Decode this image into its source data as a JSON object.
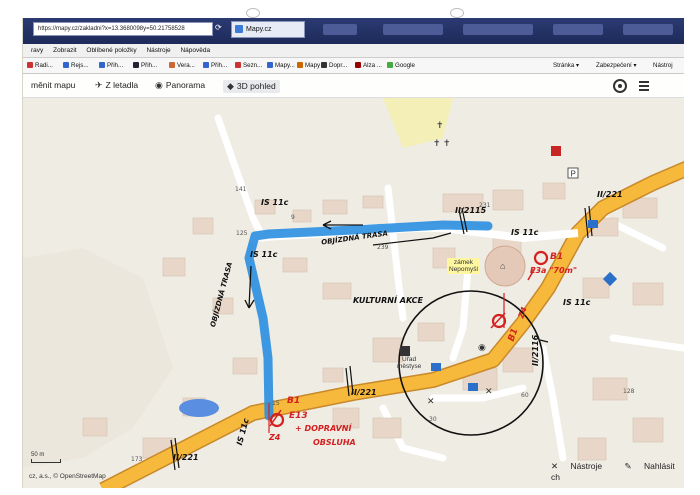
{
  "browser": {
    "address": "https://mapy.cz/zakladni?x=13.3680098y=50.21758528",
    "tab_label": "Mapy.cz",
    "menu": [
      "ravy",
      "Zobrazit",
      "Oblíbené položky",
      "Nástroje",
      "Nápověda"
    ],
    "favorites": [
      "Radi...",
      "Rejs...",
      "Přih...",
      "Přih...",
      "Vera...",
      "Přih...",
      "Sezn...",
      "Mapy...",
      "Mapy",
      "Dopr...",
      "Alza ...",
      "Google"
    ],
    "commands": [
      "Stránka ▾",
      "Zabezpečení ▾",
      "Nástroj"
    ]
  },
  "map_toolbar": {
    "change_map": "měnit mapu",
    "aerial": "Z letadla",
    "panorama": "Panorama",
    "view_3d": "3D pohled"
  },
  "map_labels": {
    "zamek": "zámek",
    "nepomysl": "Nepomyšl",
    "urad": "Úřad",
    "mestyse": "městyse",
    "numbers": [
      "141",
      "125",
      "9",
      "239",
      "231",
      "15",
      "60",
      "30",
      "173",
      "128"
    ]
  },
  "annotations": {
    "road_label_top": "II/2115",
    "road_label_left": "II/221",
    "road_label_mid": "II/221",
    "road_label_right": "II/221",
    "road_label_vertical": "II/2116",
    "sign_top_left": "IS 11c",
    "sign_left_mid": "IS 11c",
    "sign_right": "IS 11c",
    "sign_bottom": "IS 11c",
    "sign_right_b": "IS 11c",
    "detour_top": "OBJÍZDNÁ TRASA",
    "detour_left": "OBJÍZDNÁ TRASA",
    "culture": "KULTURNÍ AKCE",
    "b1_right": "B1",
    "e3a_right": "E3a \"70m\"",
    "z4_right": "Z4",
    "b1_mid": "B1",
    "b1_left": "B1",
    "e13": "E13",
    "z4_left": "Z4",
    "dopravni": "+ DOPRAVNÍ",
    "obsluha": "OBSLUHA"
  },
  "map_footer": {
    "scale_label": "50 m",
    "copyright": "cz, a.s., © OpenStreetMap",
    "tools": "Nástroje",
    "report": "Nahlásit ch"
  },
  "colors": {
    "road": "#f6b93b",
    "detour": "#2a8fe0",
    "marker": "#d42020",
    "building": "#e8d6c8"
  }
}
